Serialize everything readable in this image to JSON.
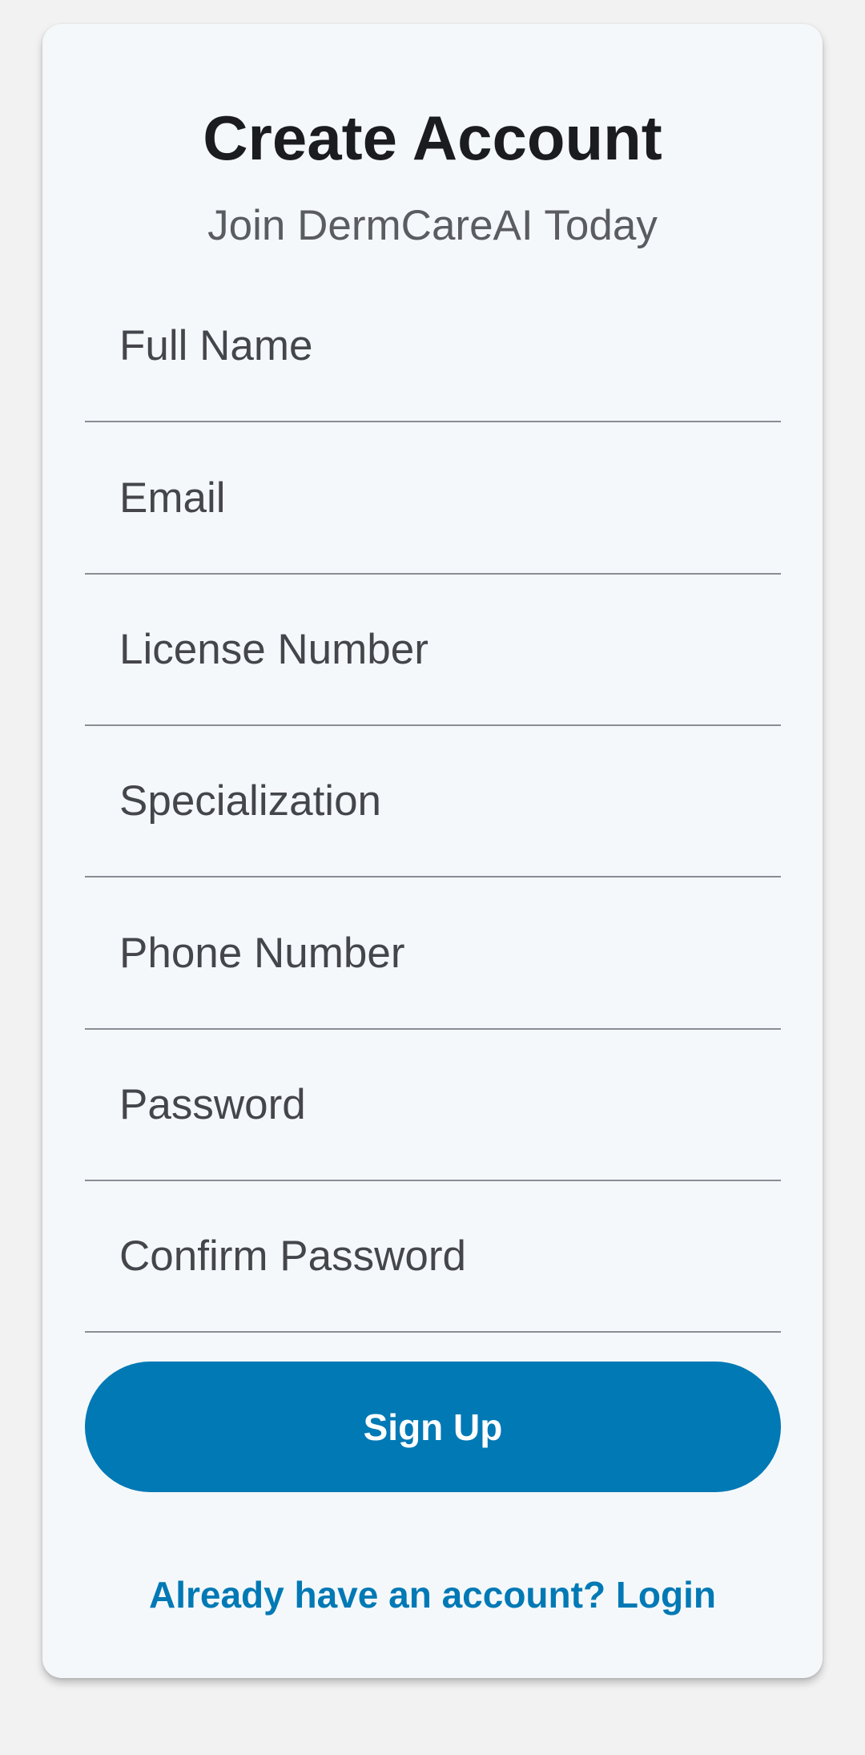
{
  "header": {
    "title": "Create Account",
    "subtitle": "Join DermCareAI Today"
  },
  "form": {
    "fields": [
      {
        "placeholder": "Full Name",
        "value": ""
      },
      {
        "placeholder": "Email",
        "value": ""
      },
      {
        "placeholder": "License Number",
        "value": ""
      },
      {
        "placeholder": "Specialization",
        "value": ""
      },
      {
        "placeholder": "Phone Number",
        "value": ""
      },
      {
        "placeholder": "Password",
        "value": ""
      },
      {
        "placeholder": "Confirm Password",
        "value": ""
      }
    ],
    "submit_label": "Sign Up",
    "login_link": "Already have an account? Login"
  },
  "colors": {
    "primary": "#0079b5",
    "card_background": "#f5f8fa",
    "page_background": "#f2f2f2",
    "title_text": "#1b1c20",
    "hint_text": "#44464c"
  }
}
